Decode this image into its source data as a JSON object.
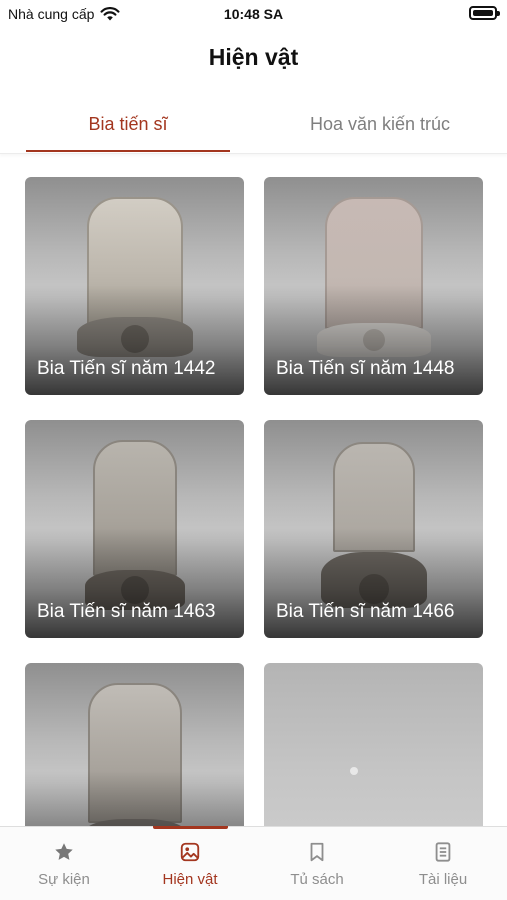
{
  "status_bar": {
    "carrier": "Nhà cung cấp",
    "time": "10:48 SA"
  },
  "header": {
    "title": "Hiện vật"
  },
  "tabs": [
    {
      "label": "Bia tiến sĩ",
      "active": true
    },
    {
      "label": "Hoa văn kiến trúc",
      "active": false
    }
  ],
  "cards": [
    {
      "title": "Bia Tiến sĩ năm 1442"
    },
    {
      "title": "Bia Tiến sĩ năm 1448"
    },
    {
      "title": "Bia Tiến sĩ năm 1463"
    },
    {
      "title": "Bia Tiến sĩ năm 1466"
    },
    {
      "title": ""
    },
    {
      "title": ""
    }
  ],
  "tab_bar": {
    "items": [
      {
        "label": "Sự kiện",
        "icon": "star-icon",
        "active": false
      },
      {
        "label": "Hiện vật",
        "icon": "image-icon",
        "active": true
      },
      {
        "label": "Tủ sách",
        "icon": "bookmark-icon",
        "active": false
      },
      {
        "label": "Tài liệu",
        "icon": "document-icon",
        "active": false
      }
    ]
  },
  "colors": {
    "accent": "#a3361f",
    "inactive": "#8e8e8e"
  }
}
